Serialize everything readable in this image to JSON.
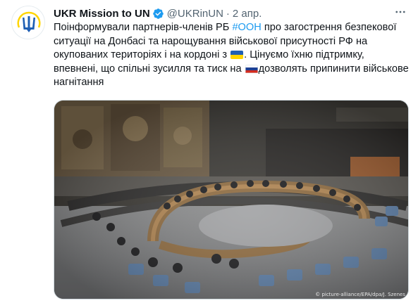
{
  "author": {
    "name": "UKR Mission to UN",
    "handle": "@UKRinUN",
    "separator": "·",
    "date": "2 апр."
  },
  "tweet": {
    "text_1": "Поінформували партнерів-членів РБ ",
    "hashtag": "#ООН",
    "text_2": " про загострення безпекової ситуації на Донбасі та нарощування військової присутності РФ на окупованих територіях і на кордоні з ",
    "text_3": ". Цінуємо їхню підтримку, впевнені, що спільні зусилля та тиск на ",
    "text_4": "дозволять припинити військове нагнітання"
  },
  "media": {
    "credit": "© picture-alliance/EPA/dpa/J. Szenes"
  },
  "icons": {
    "avatar": "ukraine-trident-icon",
    "verified": "verified-badge-icon",
    "more": "more-options-icon",
    "flag_ua": "ukraine-flag-icon",
    "flag_ru": "russia-flag-icon"
  },
  "colors": {
    "accent": "#1d9bf0",
    "secondary_text": "#536471",
    "trident": "#1f5fb4",
    "trident_yellow": "#ffd500"
  }
}
